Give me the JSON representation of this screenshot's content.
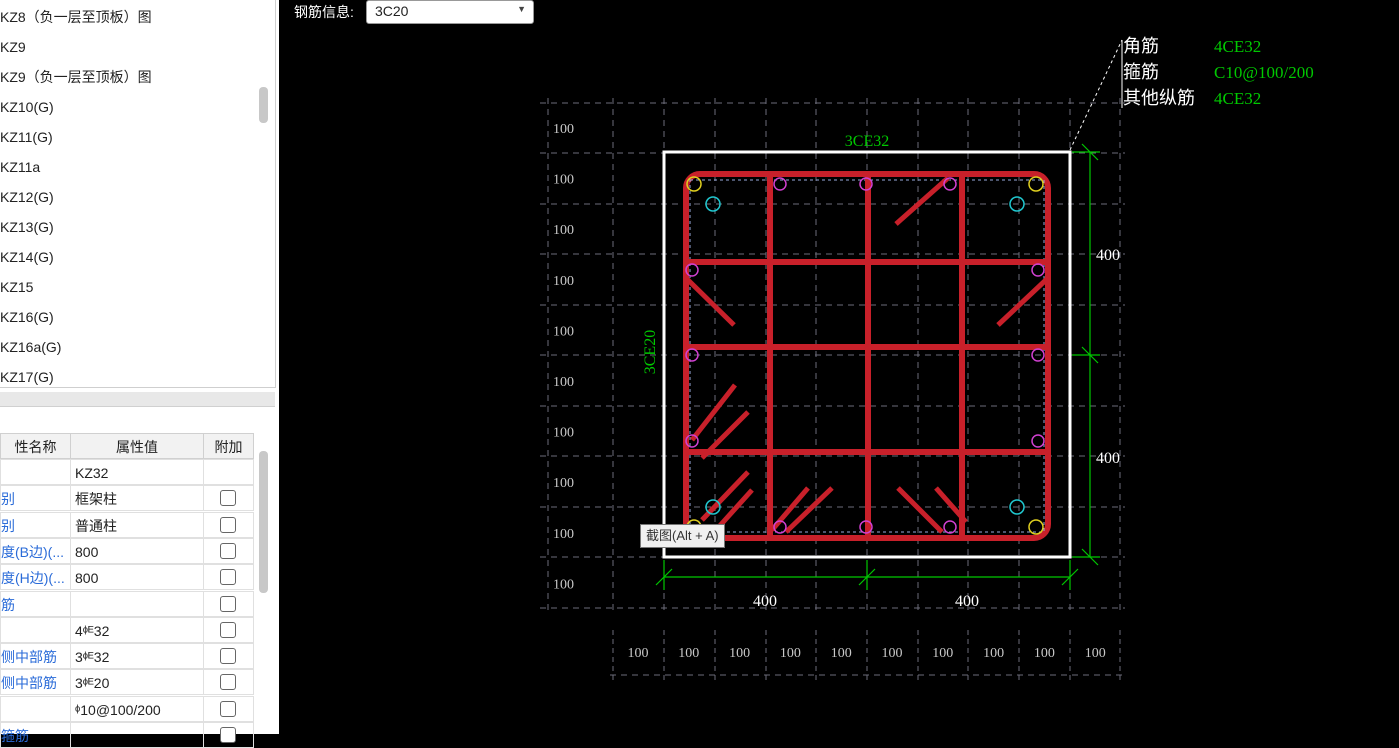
{
  "component_list": {
    "items": [
      "KZ8（负一层至顶板）图",
      "KZ9",
      "KZ9（负一层至顶板）图",
      "KZ10(G)",
      "KZ11(G)",
      "KZ11a",
      "KZ12(G)",
      "KZ13(G)",
      "KZ14(G)",
      "KZ15",
      "KZ16(G)",
      "KZ16a(G)",
      "KZ17(G)"
    ]
  },
  "properties": {
    "headers": {
      "name": "性名称",
      "value": "属性值",
      "extra": "附加"
    },
    "rows": [
      {
        "name": "",
        "value": "KZ32",
        "has_checkbox": false
      },
      {
        "name": "别",
        "value": "框架柱",
        "has_checkbox": true
      },
      {
        "name": "别",
        "value": "普通柱",
        "has_checkbox": true
      },
      {
        "name": "度(B边)(...",
        "value": "800",
        "has_checkbox": true
      },
      {
        "name": "度(H边)(...",
        "value": "800",
        "has_checkbox": true
      },
      {
        "name": "筋",
        "value": "",
        "has_checkbox": true
      },
      {
        "name": "",
        "value": "4ᶲᴱ32",
        "has_checkbox": true
      },
      {
        "name": "侧中部筋",
        "value": "3ᶲᴱ32",
        "has_checkbox": true
      },
      {
        "name": "侧中部筋",
        "value": "3ᶲᴱ20",
        "has_checkbox": true
      },
      {
        "name": "",
        "value": "ᶲ10@100/200",
        "has_checkbox": true
      },
      {
        "name": "箍筋",
        "value": "",
        "has_checkbox": true
      }
    ]
  },
  "toolbar": {
    "rebar_info_label": "钢筋信息:",
    "rebar_info_value": "3C20"
  },
  "tooltip": "截图(Alt + A)",
  "drawing": {
    "legend": [
      {
        "label": "角筋",
        "value": "4CE32"
      },
      {
        "label": "箍筋",
        "value": "C10@100/200"
      },
      {
        "label": "其他纵筋",
        "value": "4CE32"
      }
    ],
    "top_rebar_label": "3CE32",
    "side_rebar_label": "3CE20",
    "right_dims": [
      "400",
      "400"
    ],
    "bottom_dims": [
      "400",
      "400"
    ],
    "grid_left_labels": [
      "100",
      "100",
      "100",
      "100",
      "100",
      "100",
      "100",
      "100",
      "100",
      "100"
    ],
    "grid_bottom_labels": [
      "100",
      "100",
      "100",
      "100",
      "100",
      "100",
      "100",
      "100",
      "100",
      "100"
    ],
    "colors": {
      "stirrup": "#c8202a",
      "dimension": "#00c800",
      "section_outline": "#ffffff",
      "grid": "#6d6d7a",
      "corner_bar": "#e0d020",
      "middle_bar": "#d040d0",
      "tie_bar": "#20c8d0"
    }
  }
}
